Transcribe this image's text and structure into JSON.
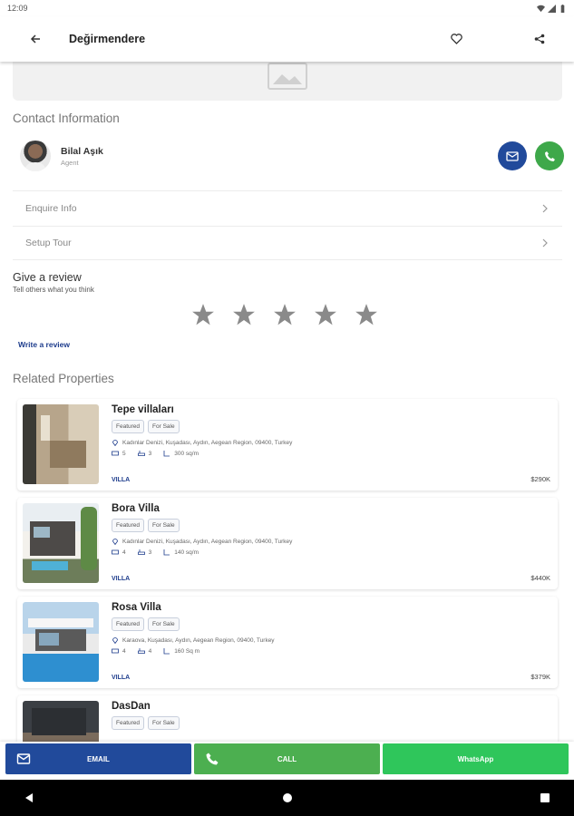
{
  "status_bar": {
    "time": "12:09"
  },
  "app_bar": {
    "title": "Değirmendere"
  },
  "contact": {
    "title": "Contact Information",
    "agent_name": "Bilal Aşık",
    "agent_role": "Agent"
  },
  "links": [
    {
      "label": "Enquire Info"
    },
    {
      "label": "Setup Tour"
    }
  ],
  "review": {
    "title": "Give a review",
    "subtitle": "Tell others what you think",
    "write_label": "Write a review",
    "rating_max": 5,
    "rating": 0
  },
  "related": {
    "title": "Related Properties",
    "properties": [
      {
        "name": "Tepe villaları",
        "tags": [
          "Featured",
          "For Sale"
        ],
        "address": "Kadınlar Denizi, Kuşadası, Aydın, Aegean Region, 09400, Turkey",
        "beds": "5",
        "baths": "3",
        "area": "300 sq/m",
        "type": "VILLA",
        "price": "$290K"
      },
      {
        "name": "Bora Villa",
        "tags": [
          "Featured",
          "For Sale"
        ],
        "address": "Kadınlar Denizi, Kuşadası, Aydın, Aegean Region, 09400, Turkey",
        "beds": "4",
        "baths": "3",
        "area": "140 sq/m",
        "type": "VILLA",
        "price": "$440K"
      },
      {
        "name": "Rosa Villa",
        "tags": [
          "Featured",
          "For Sale"
        ],
        "address": "Karaova, Kuşadası, Aydın, Aegean Region, 09400, Turkey",
        "beds": "4",
        "baths": "4",
        "area": "160 Sq m",
        "type": "VILLA",
        "price": "$379K"
      },
      {
        "name": "DasDan",
        "tags": [
          "Featured",
          "For Sale"
        ]
      }
    ]
  },
  "actions": {
    "email": "EMAIL",
    "call": "CALL",
    "whatsapp": "WhatsApp"
  },
  "colors": {
    "primary": "#214a9b",
    "call_green": "#4caf50",
    "whatsapp_green": "#2fc65b",
    "link_blue": "#1d3c8c"
  }
}
